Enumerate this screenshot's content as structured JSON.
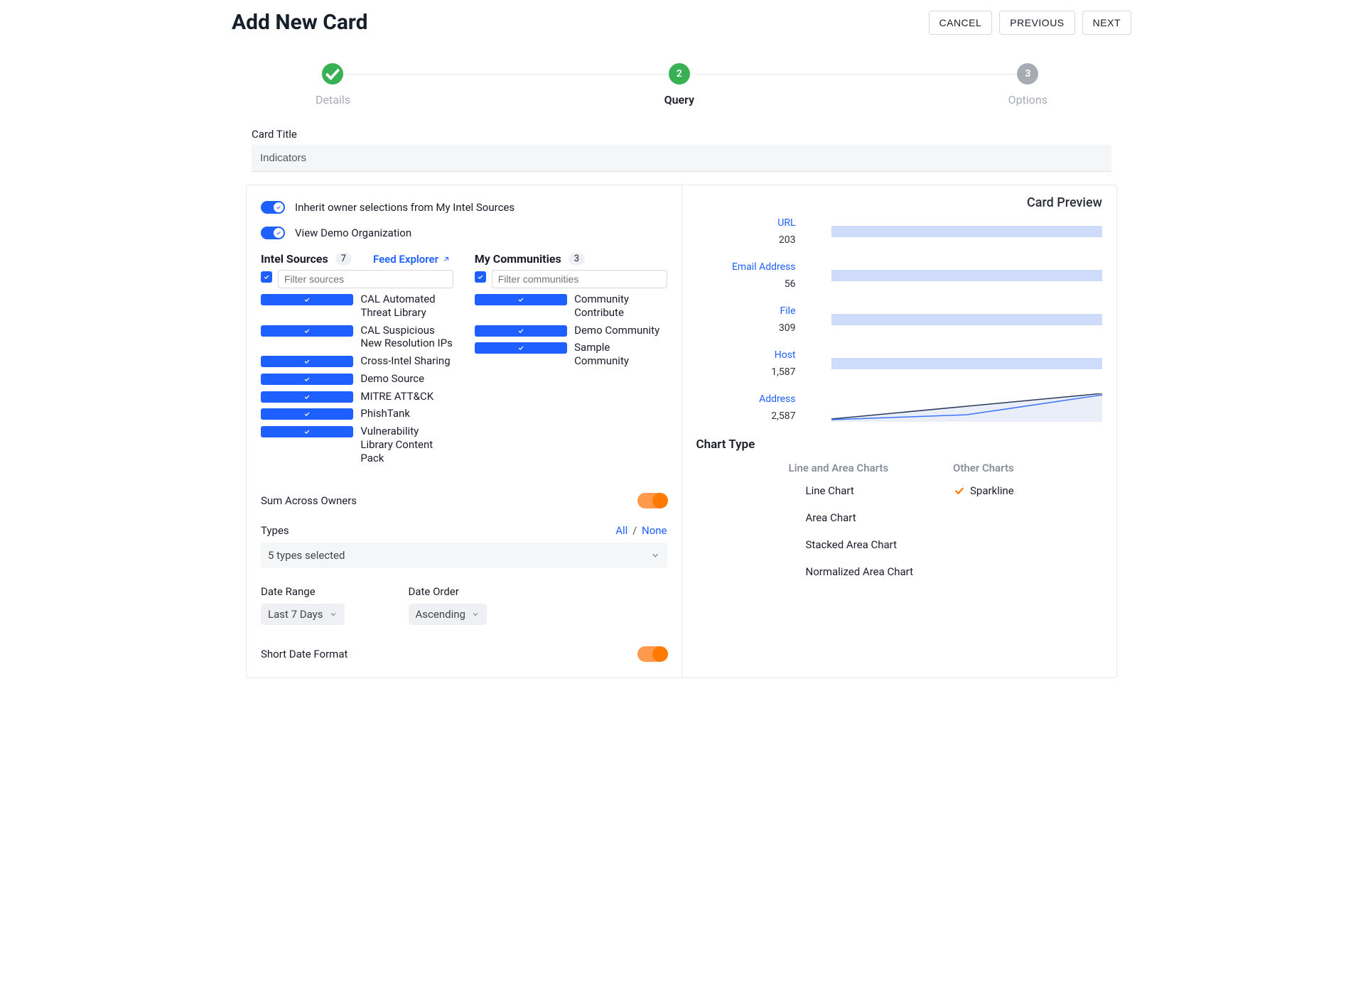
{
  "page_title": "Add New Card",
  "header_actions": {
    "cancel": "CANCEL",
    "previous": "PREVIOUS",
    "next": "NEXT"
  },
  "stepper": {
    "step1": {
      "label": "Details",
      "done": true
    },
    "step2": {
      "label": "Query",
      "number": "2"
    },
    "step3": {
      "label": "Options",
      "number": "3"
    }
  },
  "card_title": {
    "label": "Card Title",
    "value": "Indicators"
  },
  "toggles": {
    "inherit": "Inherit owner selections from My Intel Sources",
    "view_demo": "View Demo Organization"
  },
  "intel_sources": {
    "heading": "Intel Sources",
    "count": "7",
    "feed_explorer": "Feed Explorer",
    "filter_placeholder": "Filter sources",
    "items": [
      "CAL Automated Threat Library",
      "CAL Suspicious New Resolution IPs",
      "Cross-Intel Sharing",
      "Demo Source",
      "MITRE ATT&CK",
      "PhishTank",
      "Vulnerability Library Content Pack"
    ]
  },
  "my_communities": {
    "heading": "My Communities",
    "count": "3",
    "filter_placeholder": "Filter communities",
    "items": [
      "Community Contribute",
      "Demo Community",
      "Sample Community"
    ]
  },
  "sum_across_owners": "Sum Across Owners",
  "types": {
    "label": "Types",
    "all": "All",
    "none": "None",
    "selected_text": "5 types selected"
  },
  "date_range": {
    "label": "Date Range",
    "value": "Last 7 Days"
  },
  "date_order": {
    "label": "Date Order",
    "value": "Ascending"
  },
  "short_date_format": "Short Date Format",
  "preview": {
    "title": "Card Preview",
    "rows": [
      {
        "category": "URL",
        "value": "203"
      },
      {
        "category": "Email Address",
        "value": "56"
      },
      {
        "category": "File",
        "value": "309"
      },
      {
        "category": "Host",
        "value": "1,587"
      },
      {
        "category": "Address",
        "value": "2,587"
      }
    ]
  },
  "chart_type": {
    "title": "Chart Type",
    "col1_head": "Line and Area Charts",
    "col2_head": "Other Charts",
    "col1": [
      "Line Chart",
      "Area Chart",
      "Stacked Area Chart",
      "Normalized Area Chart"
    ],
    "col2_selected": "Sparkline"
  },
  "chart_data": {
    "type": "bar",
    "title": "Card Preview",
    "categories": [
      "URL",
      "Email Address",
      "File",
      "Host",
      "Address"
    ],
    "values": [
      203,
      56,
      309,
      1587,
      2587
    ]
  }
}
